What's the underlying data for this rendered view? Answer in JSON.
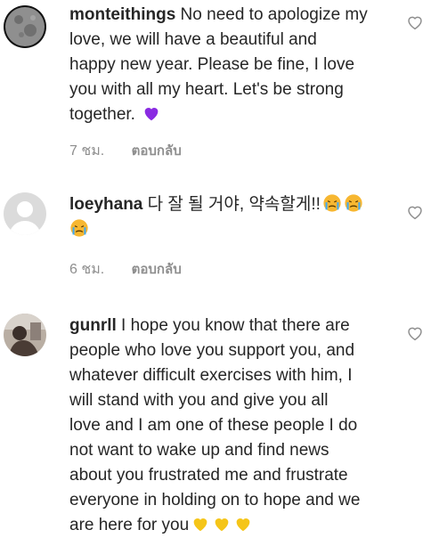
{
  "comments": [
    {
      "username": "monteithings",
      "text": " No need to apologize my\nlove, we will have a beautiful and\nhappy new year. Please be fine, I love\nyou with all my heart. Let's be strong\ntogether. ",
      "emojis": [
        "purple-heart"
      ],
      "time": "7 ชม.",
      "reply_label": "ตอบกลับ"
    },
    {
      "username": "loeyhana",
      "text": " 다 잘 될 거야, 약속할게!!",
      "emojis": [
        "crying-face",
        "crying-face",
        "crying-face"
      ],
      "time": "6 ชม.",
      "reply_label": "ตอบกลับ"
    },
    {
      "username": "gunrll",
      "text": " I hope you know that there are\npeople who love you support you, and\nwhatever difficult exercises with him, I\nwill stand with you and give you all\nlove and I am one of these people I do\nnot want to wake up and find news\nabout you frustrated me and frustrate\neveryone in holding on to hope and we\nare here for you",
      "emojis": [
        "yellow-heart",
        "yellow-heart",
        "yellow-heart"
      ]
    }
  ],
  "colors": {
    "text": "#262626",
    "muted": "#8e8e8e",
    "heart_outline": "#8e8e8e",
    "purple_heart": "#8a2be2",
    "yellow_heart": "#f5c518",
    "crying_face": "#f7b731",
    "tears": "#3fa9f5"
  }
}
